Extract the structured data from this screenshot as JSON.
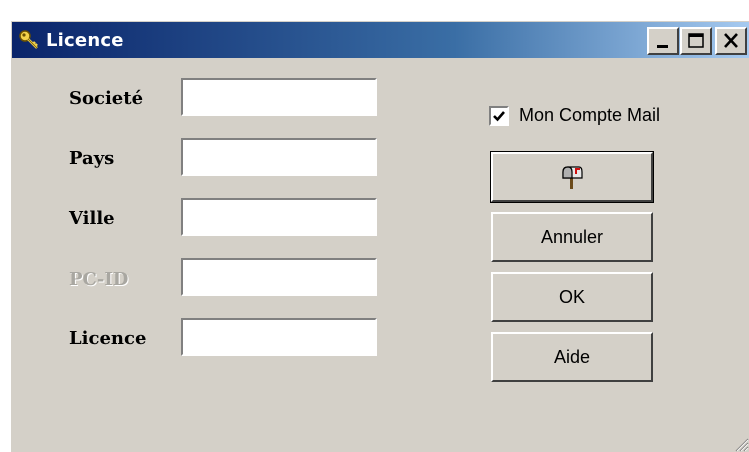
{
  "window": {
    "title": "Licence",
    "icon": "key-icon",
    "controls": {
      "minimize": "minimize-icon",
      "maximize": "maximize-icon",
      "close": "close-icon"
    }
  },
  "form": {
    "fields": [
      {
        "label": "Societé",
        "value": "",
        "enabled": true
      },
      {
        "label": "Pays",
        "value": "",
        "enabled": true
      },
      {
        "label": "Ville",
        "value": "",
        "enabled": true
      },
      {
        "label": "PC-ID",
        "value": "",
        "enabled": false
      },
      {
        "label": "Licence",
        "value": "",
        "enabled": true
      }
    ]
  },
  "options": {
    "mail_account_label": "Mon Compte Mail",
    "mail_account_checked": true
  },
  "buttons": {
    "mail_icon": "mailbox-icon",
    "cancel": "Annuler",
    "ok": "OK",
    "help": "Aide"
  },
  "colors": {
    "title_start": "#0a246a",
    "title_end": "#a6caf0",
    "face": "#d4d0c8",
    "disabled_text": "#a9a7a1"
  }
}
